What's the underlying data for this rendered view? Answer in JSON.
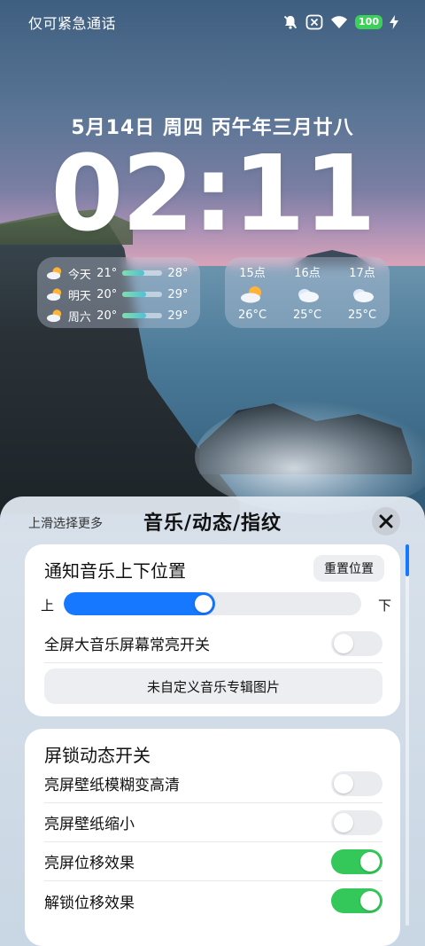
{
  "status_bar": {
    "left_text": "仅可紧急通话",
    "battery": "100",
    "icons": [
      "bell-muted-icon",
      "sim-off-icon",
      "wifi-icon",
      "battery-icon",
      "charging-icon"
    ]
  },
  "lockscreen": {
    "date_line": "5月14日 周四 丙午年三月廿八",
    "time": "02:11"
  },
  "weather": {
    "days": [
      {
        "name": "今天",
        "low": "21°",
        "high": "28°",
        "range_fraction": 0.55,
        "icon": "partly-cloudy-sun-icon"
      },
      {
        "name": "明天",
        "low": "20°",
        "high": "29°",
        "range_fraction": 0.6,
        "icon": "partly-cloudy-sun-icon"
      },
      {
        "name": "周六",
        "low": "20°",
        "high": "29°",
        "range_fraction": 0.6,
        "icon": "partly-cloudy-sun-icon"
      }
    ],
    "hours": [
      {
        "time": "15点",
        "temp": "26°C",
        "icon": "partly-cloudy-sun-icon"
      },
      {
        "time": "16点",
        "temp": "25°C",
        "icon": "cloudy-icon"
      },
      {
        "time": "17点",
        "temp": "25°C",
        "icon": "cloudy-icon"
      }
    ]
  },
  "sheet": {
    "hint": "上滑选择更多",
    "title": "音乐/动态/指纹",
    "close_icon": "close-icon",
    "scroll_position_fraction": 0.0
  },
  "music_card": {
    "title": "通知音乐上下位置",
    "reset_label": "重置位置",
    "slider_start_label": "上",
    "slider_end_label": "下",
    "slider_value_fraction": 0.47,
    "fullscreen_toggle_label": "全屏大音乐屏幕常亮开关",
    "fullscreen_toggle_on": false,
    "album_button_label": "未自定义音乐专辑图片"
  },
  "dynamic_card": {
    "title": "屏锁动态开关",
    "toggles": [
      {
        "label": "亮屏壁纸模糊变高清",
        "on": false
      },
      {
        "label": "亮屏壁纸缩小",
        "on": false
      },
      {
        "label": "亮屏位移效果",
        "on": true
      },
      {
        "label": "解锁位移效果",
        "on": true
      }
    ]
  },
  "colors": {
    "accent_blue": "#1677ff",
    "toggle_on_green": "#34c759",
    "battery_green": "#3ccf5a"
  }
}
